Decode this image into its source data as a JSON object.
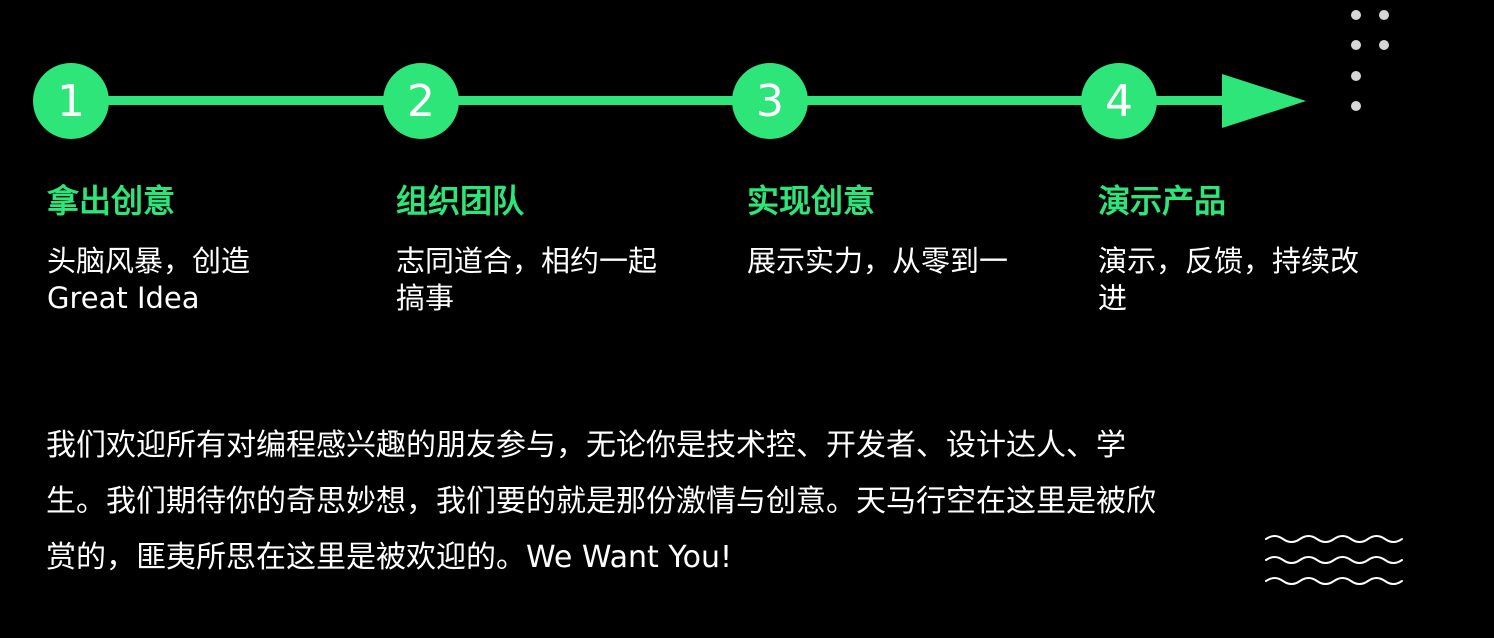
{
  "colors": {
    "accent": "#2ee57a",
    "background": "#000000",
    "text": "#ffffff",
    "dots": "#d6d6d6"
  },
  "steps": [
    {
      "number": "1",
      "title": "拿出创意",
      "desc": "头脑风暴，创造 Great Idea"
    },
    {
      "number": "2",
      "title": "组织团队",
      "desc": "志同道合，相约一起搞事"
    },
    {
      "number": "3",
      "title": "实现创意",
      "desc": "展示实力，从零到一"
    },
    {
      "number": "4",
      "title": "演示产品",
      "desc": "演示，反馈，持续改进"
    }
  ],
  "intro": "我们欢迎所有对编程感兴趣的朋友参与，无论你是技术控、开发者、设计达人、学生。我们期待你的奇思妙想，我们要的就是那份激情与创意。天马行空在这里是被欣赏的，匪夷所思在这里是被欢迎的。We Want You!",
  "decorations": {
    "timeline": "arrow-line",
    "top_right": "dots-pattern",
    "bottom_right": "wave-lines-icon"
  }
}
